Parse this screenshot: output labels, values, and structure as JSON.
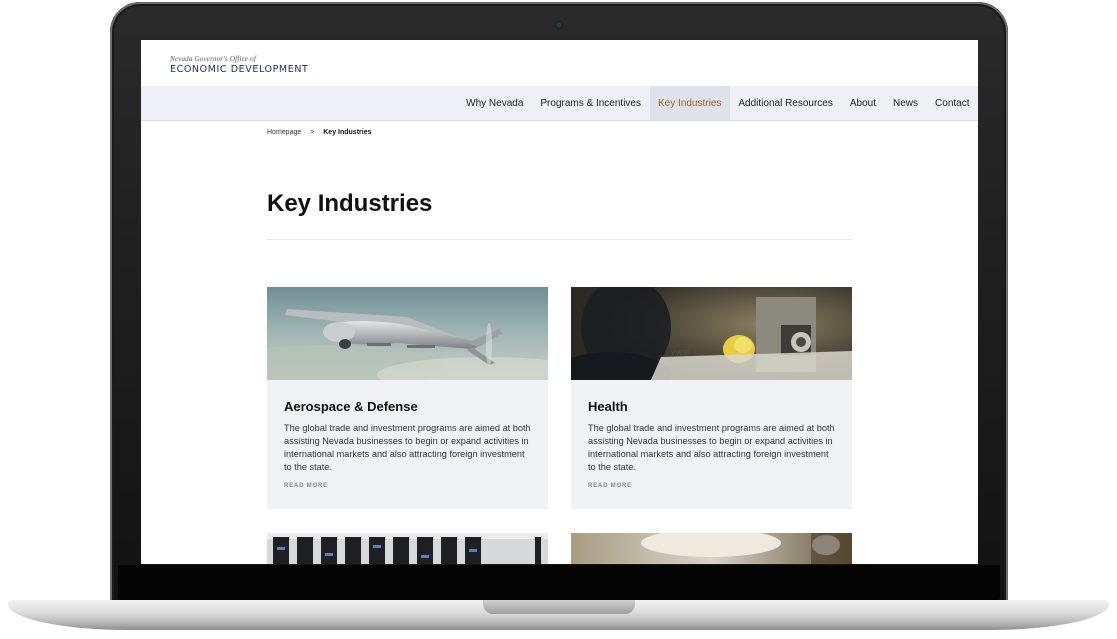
{
  "header": {
    "logo_small": "Nevada Governor's Office of",
    "logo_main": "ECONOMIC DEVELOPMENT"
  },
  "nav": {
    "items": [
      {
        "label": "Why Nevada"
      },
      {
        "label": "Programs & Incentives"
      },
      {
        "label": "Key Industries",
        "active": true
      },
      {
        "label": "Additional Resources"
      },
      {
        "label": "About"
      },
      {
        "label": "News"
      },
      {
        "label": "Contact"
      }
    ],
    "active_color": "#a0641f"
  },
  "breadcrumb": {
    "home": "Homepage",
    "separator": ">",
    "current": "Key Industries"
  },
  "page": {
    "title": "Key Industries"
  },
  "cards": [
    {
      "title": "Aerospace & Defense",
      "description": "The global trade and investment programs are aimed at both assisting Nevada businesses to begin or expand activities in international markets and also attracting foreign investment to the state.",
      "link": "READ MORE",
      "image": "drone-image"
    },
    {
      "title": "Health",
      "description": "The global trade and investment programs are aimed at both assisting Nevada businesses to begin or expand activities in international markets and also attracting foreign investment to the state.",
      "link": "READ MORE",
      "image": "medical-equipment-image"
    }
  ],
  "colors": {
    "nav_bg": "#eef0f5",
    "card_bg": "#f1f2f6",
    "logo_text": "#1e2b57"
  }
}
